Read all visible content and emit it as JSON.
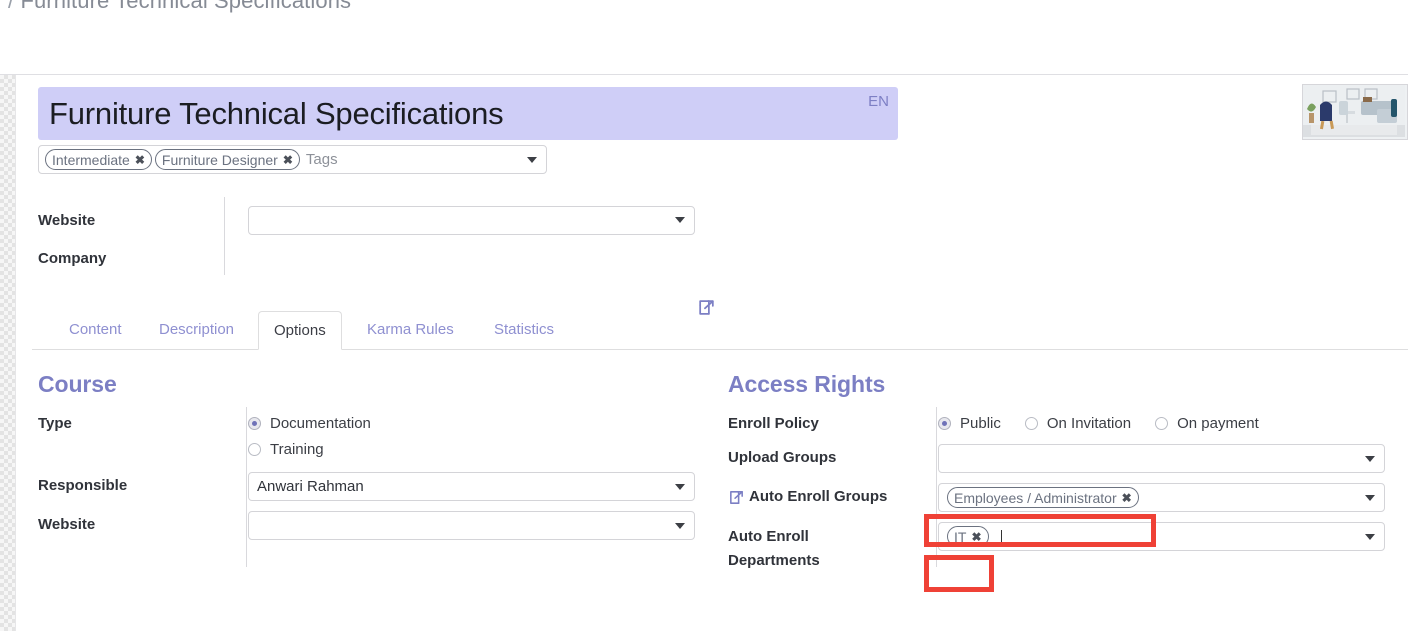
{
  "breadcrumb": {
    "separator": "/",
    "current": "Furniture Technical Specifications"
  },
  "record": {
    "title": "Furniture Technical Specifications",
    "language_badge": "EN",
    "thumbnail_alt": "living-room-furniture-photo"
  },
  "tags_field": {
    "chips": [
      {
        "label": "Intermediate",
        "remove": "✖"
      },
      {
        "label": "Furniture Designer",
        "remove": "✖"
      }
    ],
    "placeholder": "Tags"
  },
  "top_fields": [
    {
      "label": "Website",
      "value": ""
    },
    {
      "label": "Company",
      "value": ""
    }
  ],
  "tabs": [
    {
      "label": "Content",
      "active": false
    },
    {
      "label": "Description",
      "active": false
    },
    {
      "label": "Options",
      "active": true
    },
    {
      "label": "Karma Rules",
      "active": false
    },
    {
      "label": "Statistics",
      "active": false
    }
  ],
  "course": {
    "section_title": "Course",
    "type_label": "Type",
    "type_options": [
      {
        "label": "Documentation",
        "selected": true
      },
      {
        "label": "Training",
        "selected": false
      }
    ],
    "responsible_label": "Responsible",
    "responsible_value": "Anwari Rahman",
    "website_label": "Website",
    "website_value": ""
  },
  "access_rights": {
    "section_title": "Access Rights",
    "enroll_policy_label": "Enroll Policy",
    "enroll_policy_options": [
      {
        "label": "Public",
        "selected": true
      },
      {
        "label": "On Invitation",
        "selected": false
      },
      {
        "label": "On payment",
        "selected": false
      }
    ],
    "upload_groups_label": "Upload Groups",
    "upload_groups_value": "",
    "auto_enroll_groups_label": "Auto Enroll Groups",
    "auto_enroll_groups_chip": "Employees / Administrator",
    "auto_enroll_groups_chip_remove": "✖",
    "auto_enroll_departments_label_line1": "Auto Enroll",
    "auto_enroll_departments_label_line2": "Departments",
    "auto_enroll_departments_chip": "IT",
    "auto_enroll_departments_chip_remove": "✖"
  },
  "colors": {
    "title_background": "#cfcef7",
    "section_heading": "#7c7fc4",
    "tab_inactive": "#8f90d1",
    "highlight_box": "#ef4136",
    "radio_dot": "#6f72b8"
  }
}
